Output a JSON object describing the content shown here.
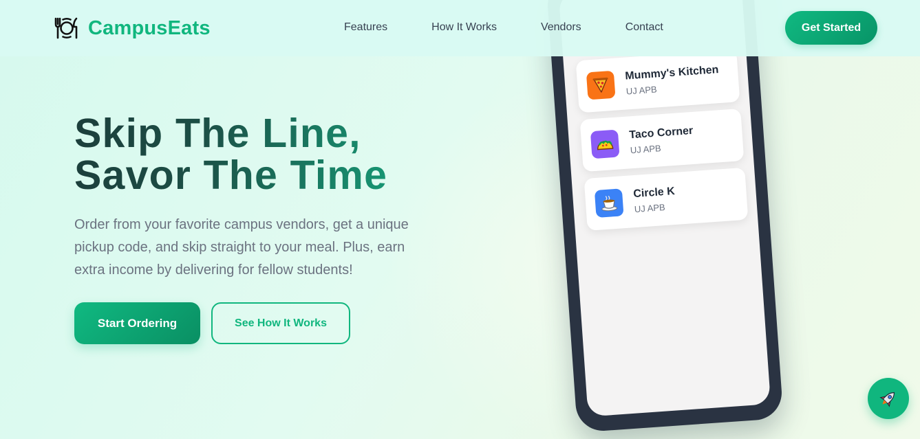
{
  "brand": {
    "name": "CampusEats",
    "icon": "plate-cutlery-icon"
  },
  "nav": {
    "links": [
      "Features",
      "How It Works",
      "Vendors",
      "Contact"
    ],
    "cta_label": "Get Started"
  },
  "hero": {
    "title_line1": "Skip The Line,",
    "title_line2": "Savor The Time",
    "subtitle": "Order from your favorite campus vendors, get a unique pickup code, and skip straight to your meal. Plus, earn extra income by delivering for fellow students!",
    "primary_label": "Start Ordering",
    "secondary_label": "See How It Works"
  },
  "phone": {
    "vendors": [
      {
        "name": "Mummy's Kitchen",
        "location": "UJ APB",
        "icon": "pizza-icon",
        "color": "#f97316"
      },
      {
        "name": "Taco Corner",
        "location": "UJ APB",
        "icon": "taco-icon",
        "color": "#8b5cf6"
      },
      {
        "name": "Circle K",
        "location": "UJ APB",
        "icon": "coffee-cup-icon",
        "color": "#3b82f6"
      }
    ]
  },
  "fab": {
    "icon": "rocket-icon"
  },
  "colors": {
    "accent": "#10b67e",
    "phone_frame": "#2a3342",
    "title_dark": "#1c3e3b"
  }
}
